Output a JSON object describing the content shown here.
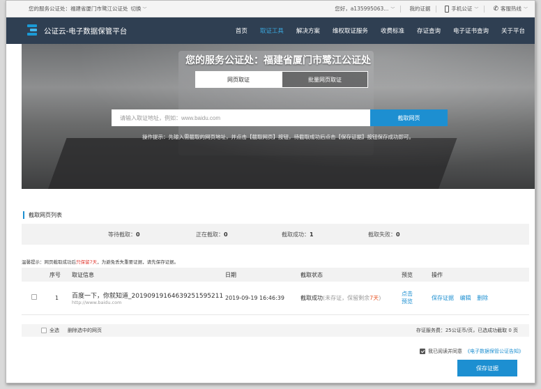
{
  "topbar": {
    "office_label": "您的服务公证处：福建省厦门市鹭江公证处",
    "switch_label": "切换",
    "greeting": "您好，a135995063...",
    "my_certs": "我的证据",
    "mobile": "手机公证",
    "hotline": "客服热线"
  },
  "nav": {
    "brand": "公证云-电子数据保管平台",
    "items": [
      "首页",
      "取证工具",
      "解决方案",
      "维权取证服务",
      "收费标准",
      "存证查询",
      "电子证书查询",
      "关于平台"
    ]
  },
  "hero": {
    "title": "您的服务公证处：福建省厦门市鹭江公证处",
    "tab_single": "网页取证",
    "tab_batch": "批量网页取证",
    "search_placeholder": "请输入取证地址，例如：www.baidu.com",
    "capture_button": "截取网页",
    "tip": "操作提示：先输入需截取的网页地址，并点击【截取网页】按钮，待截取成功后点击【保存证据】按钮保存成功即可。"
  },
  "section": {
    "title": "截取网页列表",
    "stats": {
      "waiting_label": "等待截取：",
      "waiting": "0",
      "capturing_label": "正在截取：",
      "capturing": "0",
      "success_label": "截取成功：",
      "success": "1",
      "failed_label": "截取失败：",
      "failed": "0"
    },
    "notice_prefix": "温馨提示：网页截取成功后",
    "notice_red": "只保留7天",
    "notice_suffix": "，为避免丢失重要证据，请先保存证据。"
  },
  "table": {
    "headers": [
      "序号",
      "取证信息",
      "日期",
      "截取状态",
      "预览",
      "操作"
    ],
    "rows": [
      {
        "index": "1",
        "title": "百度一下，你就知道_20190919164639251595211",
        "url": "http://www.baidu.com",
        "date": "2019-09-19 16:46:39",
        "status": "截取成功",
        "status_note_a": "(未存证，保留剩余",
        "status_days": "7天",
        "status_note_b": ")",
        "preview_a": "点击",
        "preview_b": "预览",
        "action_save": "保存证据",
        "action_edit": "编辑",
        "action_delete": "删除"
      }
    ]
  },
  "footer": {
    "select_all": "全选",
    "delete_selected": "删除选中的网页",
    "fee_info": "存证服务费：25公证币/页，已选成功截取 0 页",
    "agree_prefix": "我已阅读并同意",
    "agree_link": "《电子数据保管公证告知》",
    "save_button": "保存证据"
  },
  "colors": {
    "nav_bg": "#2f3f52",
    "accent": "#1d8fd1",
    "warning": "#e0342c"
  }
}
